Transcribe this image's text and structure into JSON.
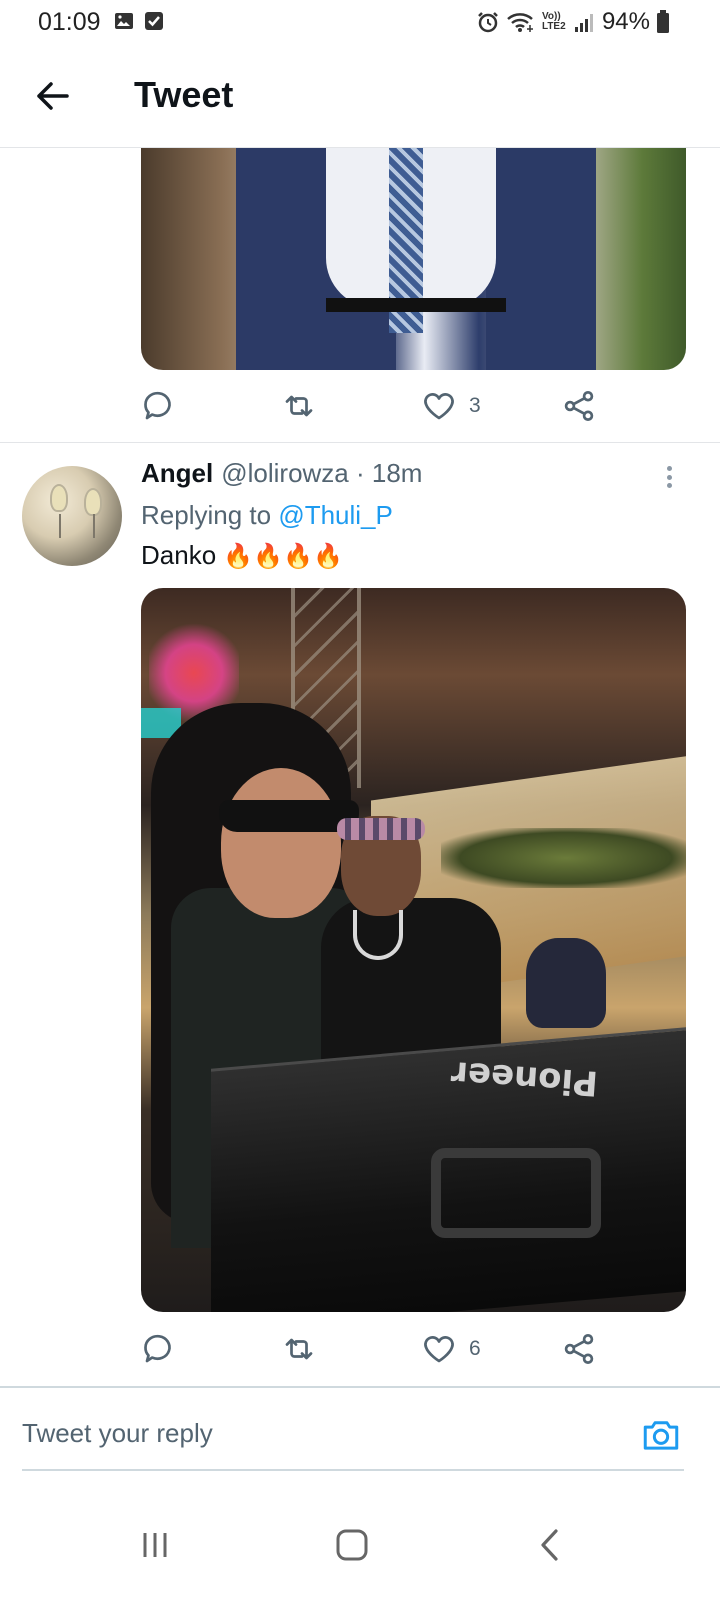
{
  "status_bar": {
    "time": "01:09",
    "battery_percent": "94%",
    "left_icons": [
      "gallery-icon",
      "checkbox-icon"
    ],
    "right_icons": [
      "alarm-icon",
      "wifi-icon",
      "volte-icon",
      "signal-icon",
      "battery-icon"
    ],
    "volte_label": "Vo)) LTE2"
  },
  "header": {
    "title": "Tweet",
    "back_icon": "back-arrow-icon"
  },
  "previous_tweet": {
    "actions": {
      "reply_count": "",
      "retweet_count": "",
      "like_count": "3"
    }
  },
  "tweet": {
    "author_name": "Angel",
    "author_handle": "@lolirowza · 18m",
    "replying_prefix": "Replying to ",
    "replying_to": "@Thuli_P",
    "text": "Danko",
    "emoji": "🔥🔥🔥🔥",
    "actions": {
      "reply_count": "",
      "retweet_count": "",
      "like_count": "6"
    }
  },
  "media_text": {
    "case_brand": "Pioneer"
  },
  "composer": {
    "placeholder": "Tweet your reply"
  },
  "colors": {
    "accent": "#1d9bf0",
    "secondary_text": "#536471",
    "primary_text": "#0f1419"
  }
}
